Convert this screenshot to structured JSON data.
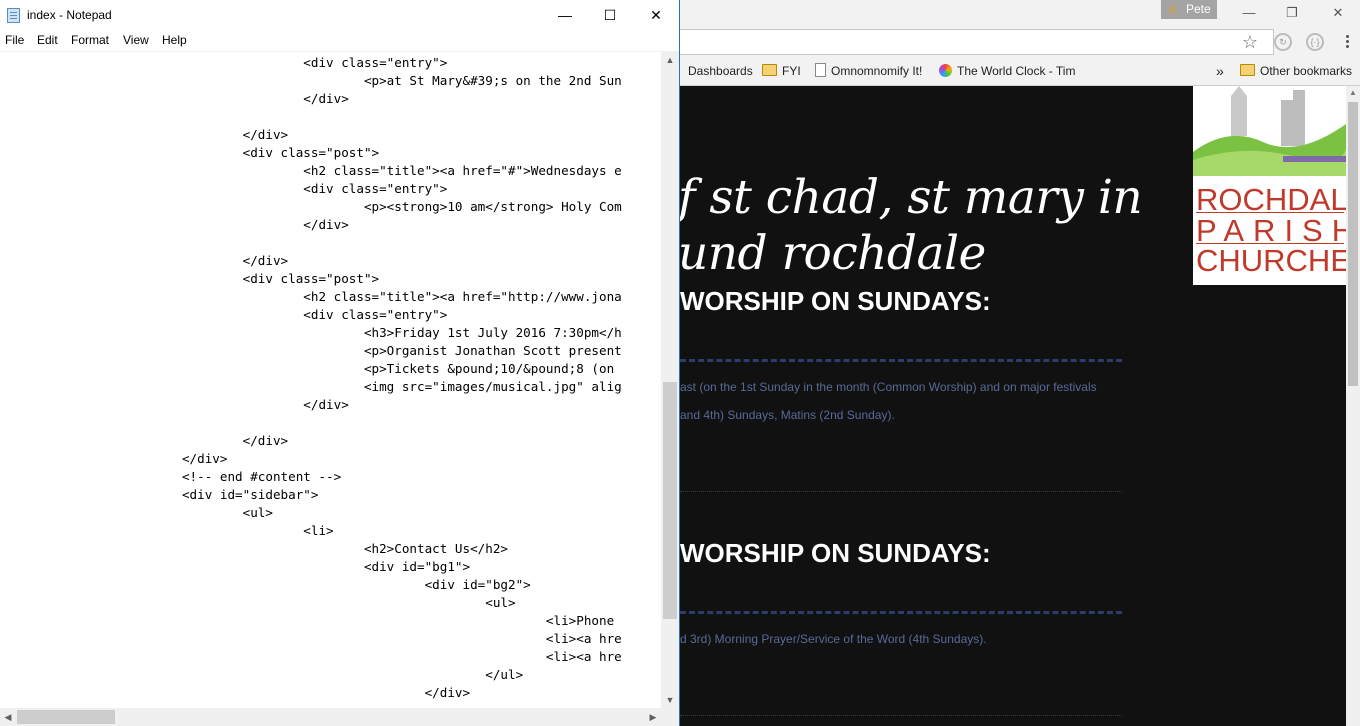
{
  "browser": {
    "profile_name": "Pete",
    "warning_icon": "warning-icon",
    "window_buttons": {
      "minimize": "—",
      "restore": "❐",
      "close": "✕"
    },
    "star_icon": "☆",
    "bookmarks": {
      "dashboards": "Dashboards",
      "fyi": "FYI",
      "omnomnomify": "Omnomnomify It!",
      "world_clock": "The World Clock - Tim",
      "more": "»",
      "other": "Other bookmarks"
    },
    "page": {
      "title_line1": "f st chad, st mary in",
      "title_line2": "und rochdale",
      "sections": [
        {
          "heading": "WORSHIP ON SUNDAYS:",
          "text1": "ast (on the 1st Sunday in the month (Common Worship) and on major festivals",
          "text2": "and 4th) Sundays, Matins (2nd Sunday)."
        },
        {
          "heading": "WORSHIP ON SUNDAYS:",
          "text1": "d 3rd) Morning Prayer/Service of the Word (4th Sundays)."
        }
      ],
      "logo": {
        "line1": "ROCHDALE",
        "line2": "PARISH",
        "line3": "CHURCHES"
      }
    }
  },
  "notepad": {
    "title": "index - Notepad",
    "window_buttons": {
      "minimize": "—",
      "maximize": "☐",
      "close": "✕"
    },
    "menu": {
      "file": "File",
      "edit": "Edit",
      "format": "Format",
      "view": "View",
      "help": "Help"
    },
    "lines": [
      "                                        <div class=\"entry\">",
      "                                                <p>at St Mary&#39;s on the 2nd Sun",
      "                                        </div>",
      "",
      "                                </div>",
      "                                <div class=\"post\">",
      "                                        <h2 class=\"title\"><a href=\"#\">Wednesdays e",
      "                                        <div class=\"entry\">",
      "                                                <p><strong>10 am</strong> Holy Com",
      "                                        </div>",
      "",
      "                                </div>",
      "                                <div class=\"post\">",
      "                                        <h2 class=\"title\"><a href=\"http://www.jona",
      "                                        <div class=\"entry\">",
      "                                                <h3>Friday 1st July 2016 7:30pm</h",
      "                                                <p>Organist Jonathan Scott present",
      "                                                <p>Tickets &pound;10/&pound;8 (on",
      "                                                <img src=\"images/musical.jpg\" alig",
      "                                        </div>",
      "",
      "                                </div>",
      "                        </div>",
      "                        <!-- end #content -->",
      "                        <div id=\"sidebar\">",
      "                                <ul>",
      "                                        <li>",
      "                                                <h2>Contact Us</h2>",
      "                                                <div id=\"bg1\">",
      "                                                        <div id=\"bg2\">",
      "                                                                <ul>",
      "                                                                        <li>Phone",
      "                                                                        <li><a hre",
      "                                                                        <li><a hre",
      "                                                                </ul>",
      "                                                        </div>"
    ]
  }
}
